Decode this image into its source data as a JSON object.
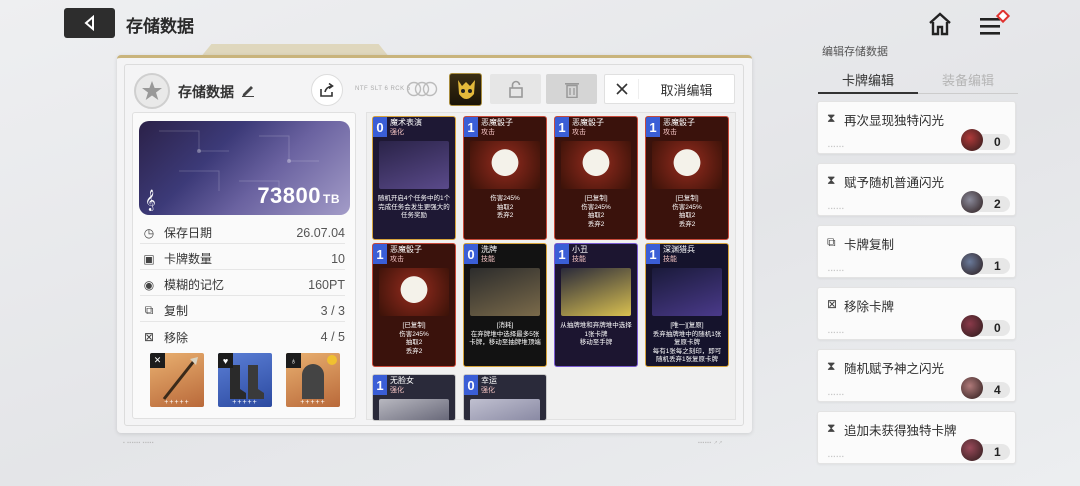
{
  "header": {
    "title": "存储数据"
  },
  "save": {
    "name": "存储数据",
    "tiny_code": "NTF SLT 6 RCK 5",
    "cancel_label": "取消编辑",
    "tb_value": "73800",
    "tb_unit": "TB",
    "stats": [
      {
        "icon": "clock-icon",
        "glyph": "◷",
        "label": "保存日期",
        "value": "26.07.04"
      },
      {
        "icon": "card-count-icon",
        "glyph": "▣",
        "label": "卡牌数量",
        "value": "10"
      },
      {
        "icon": "memory-icon",
        "glyph": "◉",
        "label": "模糊的记忆",
        "value": "160PT"
      },
      {
        "icon": "copy-icon",
        "glyph": "⧉",
        "label": "复制",
        "value": "3 / 3"
      },
      {
        "icon": "remove-icon",
        "glyph": "⊠",
        "label": "移除",
        "value": "4 / 5"
      }
    ],
    "equipment": [
      {
        "type": "weapon",
        "corner": "✕",
        "stars": "+++++"
      },
      {
        "type": "armor",
        "corner": "♥",
        "stars": "+++++"
      },
      {
        "type": "accessory",
        "corner": "♁",
        "stars": "+++++"
      }
    ]
  },
  "cards": [
    {
      "cost": "0",
      "name": "魔术表演",
      "type": "强化",
      "text": "随机开启4个任务中的1个\n完成任务会发生更强大的任务奖励",
      "accent": "#d6a23a"
    },
    {
      "cost": "1",
      "name": "恶魔骰子",
      "type": "攻击",
      "text": "伤害245%\n抽取2\n丢弃2",
      "accent": "#c84a3a"
    },
    {
      "cost": "1",
      "name": "恶魔骰子",
      "type": "攻击",
      "text": "[已复制]\n伤害245%\n抽取2\n丢弃2",
      "accent": "#c84a3a"
    },
    {
      "cost": "1",
      "name": "恶魔骰子",
      "type": "攻击",
      "text": "[已复制]\n伤害245%\n抽取2\n丢弃2",
      "accent": "#c84a3a"
    },
    {
      "cost": "1",
      "name": "恶魔骰子",
      "type": "攻击",
      "text": "[已复制]\n伤害245%\n抽取2\n丢弃2",
      "accent": "#c84a3a"
    },
    {
      "cost": "0",
      "name": "洗牌",
      "type": "技能",
      "text": "[消耗]\n在弃牌堆中选择最多5张卡牌，移动至抽牌堆顶端",
      "accent": "#d6a23a"
    },
    {
      "cost": "1",
      "name": "小丑",
      "type": "技能",
      "text": "从抽牌堆和弃牌堆中选择1张卡牌\n移动至手牌",
      "accent": "#7a5ad0"
    },
    {
      "cost": "1",
      "name": "深渊猎兵",
      "type": "技能",
      "text": "[唯一][复原]\n丢弃抽牌堆中的随机1张复原卡牌\n每有1张每之刻印，即可随机丢弃1张复原卡牌",
      "accent": "#d6a23a"
    },
    {
      "cost": "1",
      "name": "无脸女",
      "type": "强化",
      "text": "",
      "accent": "#c8c8c8"
    },
    {
      "cost": "0",
      "name": "幸运",
      "type": "强化",
      "text": "",
      "accent": "#c8c8c8"
    }
  ],
  "right": {
    "subtitle": "编辑存储数据",
    "tabs": [
      "卡牌编辑",
      "装备编辑"
    ],
    "options": [
      {
        "icon": "flash-icon",
        "label": "再次显现独特闪光",
        "count": "0"
      },
      {
        "icon": "flash-icon",
        "label": "赋予随机普通闪光",
        "count": "2"
      },
      {
        "icon": "copy-icon",
        "label": "卡牌复制",
        "count": "1"
      },
      {
        "icon": "remove-icon",
        "label": "移除卡牌",
        "count": "0"
      },
      {
        "icon": "flash-icon",
        "label": "随机赋予神之闪光",
        "count": "4"
      },
      {
        "icon": "flash-icon",
        "label": "追加未获得独特卡牌",
        "count": "1"
      }
    ]
  },
  "colors": {
    "accent_gold": "#c9b47c",
    "dark": "#2d2d2d",
    "banner": "#3c3a78"
  }
}
